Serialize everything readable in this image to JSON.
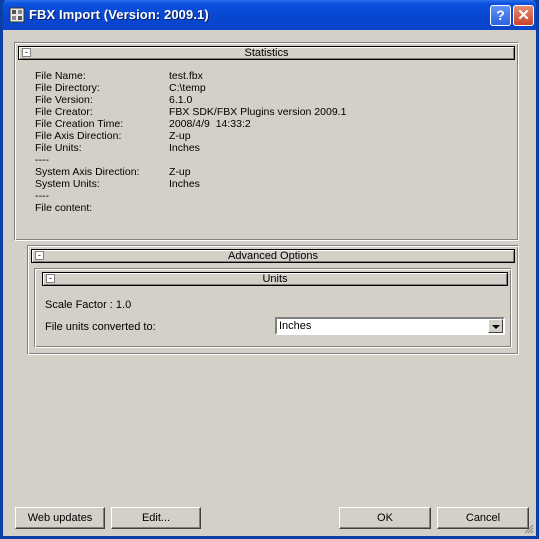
{
  "window": {
    "title": "FBX Import (Version: 2009.1)"
  },
  "statistics": {
    "header": "Statistics",
    "rows": [
      {
        "label": "File Name:",
        "value": "test.fbx"
      },
      {
        "label": "File Directory:",
        "value": "C:\\temp"
      },
      {
        "label": "File Version:",
        "value": "6.1.0"
      },
      {
        "label": "File Creator:",
        "value": "FBX SDK/FBX Plugins version 2009.1"
      },
      {
        "label": "File Creation Time:",
        "value": "2008/4/9  14:33:2"
      },
      {
        "label": "File Axis Direction:",
        "value": "Z-up"
      },
      {
        "label": "File Units:",
        "value": "Inches"
      },
      {
        "label": "----",
        "value": ""
      },
      {
        "label": "System Axis Direction:",
        "value": "Z-up"
      },
      {
        "label": "System Units:",
        "value": "Inches"
      },
      {
        "label": "----",
        "value": ""
      },
      {
        "label": "File content:",
        "value": ""
      }
    ]
  },
  "advanced": {
    "header": "Advanced Options",
    "units": {
      "header": "Units",
      "scale_factor": "Scale Factor : 1.0",
      "converted_label": "File units converted to:",
      "converted_value": "Inches"
    }
  },
  "buttons": {
    "web_updates": "Web updates",
    "edit": "Edit...",
    "ok": "OK",
    "cancel": "Cancel"
  }
}
